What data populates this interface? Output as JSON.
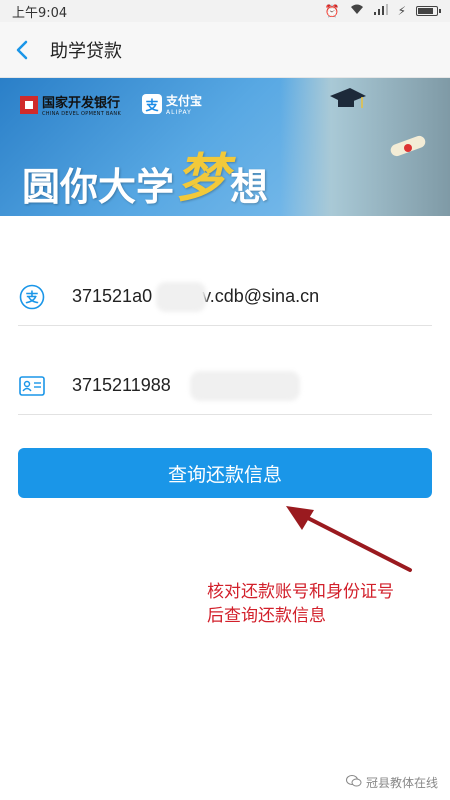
{
  "status_bar": {
    "time": "上午9:04",
    "battery_level": 0.9
  },
  "nav": {
    "title": "助学贷款",
    "back_icon": "chevron-left-icon"
  },
  "banner": {
    "bank_name_cn": "国家开发银行",
    "bank_name_en": "CHINA DEVEL OPMENT BANK",
    "alipay_mark": "支",
    "alipay_cn": "支付宝",
    "alipay_en": "ALIPAY",
    "slogan_part1": "圆你大学",
    "slogan_dream": "梦",
    "slogan_part2": "想"
  },
  "form": {
    "account_icon": "alipay-icon",
    "account_value_start": "371521a0",
    "account_value_end": "v.cdb@sina.cn",
    "id_icon": "id-card-icon",
    "id_value": "3715211988"
  },
  "button": {
    "label": "查询还款信息"
  },
  "annotation": {
    "line1": "核对还款账号和身份证号",
    "line2": "后查询还款信息",
    "color": "#d2202b"
  },
  "watermark": {
    "text": "冠县教体在线"
  },
  "colors": {
    "accent": "#1a96e8",
    "banner": "#2a7fc8"
  }
}
